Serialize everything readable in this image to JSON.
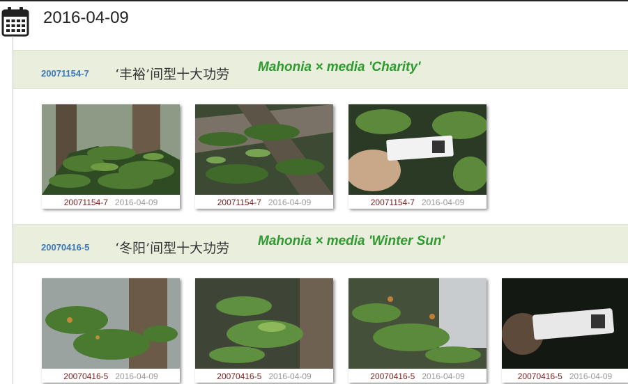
{
  "page": {
    "date": "2016-04-09"
  },
  "icons": {
    "calendar": "calendar-icon"
  },
  "groups": [
    {
      "accession": "20071154-7",
      "chinese_name": "‘丰裕’间型十大功劳",
      "scientific_name": "Mahonia × media 'Charity'",
      "photos": [
        {
          "id": "20071154-7",
          "date": "2016-04-09",
          "kind": "shrub"
        },
        {
          "id": "20071154-7",
          "date": "2016-04-09",
          "kind": "foliage"
        },
        {
          "id": "20071154-7",
          "date": "2016-04-09",
          "kind": "label"
        }
      ]
    },
    {
      "accession": "20070416-5",
      "chinese_name": "‘冬阳’间型十大功劳",
      "scientific_name": "Mahonia × media 'Winter Sun'",
      "photos": [
        {
          "id": "20070416-5",
          "date": "2016-04-09",
          "kind": "shrub"
        },
        {
          "id": "20070416-5",
          "date": "2016-04-09",
          "kind": "foliage"
        },
        {
          "id": "20070416-5",
          "date": "2016-04-09",
          "kind": "foliage"
        },
        {
          "id": "20070416-5",
          "date": "2016-04-09",
          "kind": "dark-label"
        }
      ]
    }
  ]
}
